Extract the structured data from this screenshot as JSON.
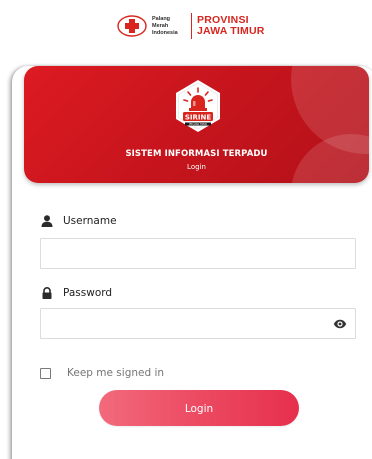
{
  "brand": {
    "org_line1": "Palang",
    "org_line2": "Merah",
    "org_line3": "Indonesia",
    "province_line1": "PROVINSI",
    "province_line2": "JAWA TIMUR",
    "logo_icon": "red-cross-logo-icon",
    "accent_color": "#d8261f"
  },
  "header": {
    "badge_label": "SIRINE",
    "badge_sublabel": "PMI JAWA TIMUR",
    "title": "SISTEM INFORMASI TERPADU",
    "subtitle": "Login",
    "color": "#c4141c"
  },
  "form": {
    "username_label": "Username",
    "username_value": "",
    "username_icon": "user-icon",
    "password_label": "Password",
    "password_value": "",
    "password_icon": "lock-icon",
    "toggle_icon": "eye-icon",
    "keep_signed_in_label": "Keep me signed in",
    "keep_signed_in_checked": false,
    "login_button_label": "Login",
    "button_color": "#ec4a62"
  }
}
